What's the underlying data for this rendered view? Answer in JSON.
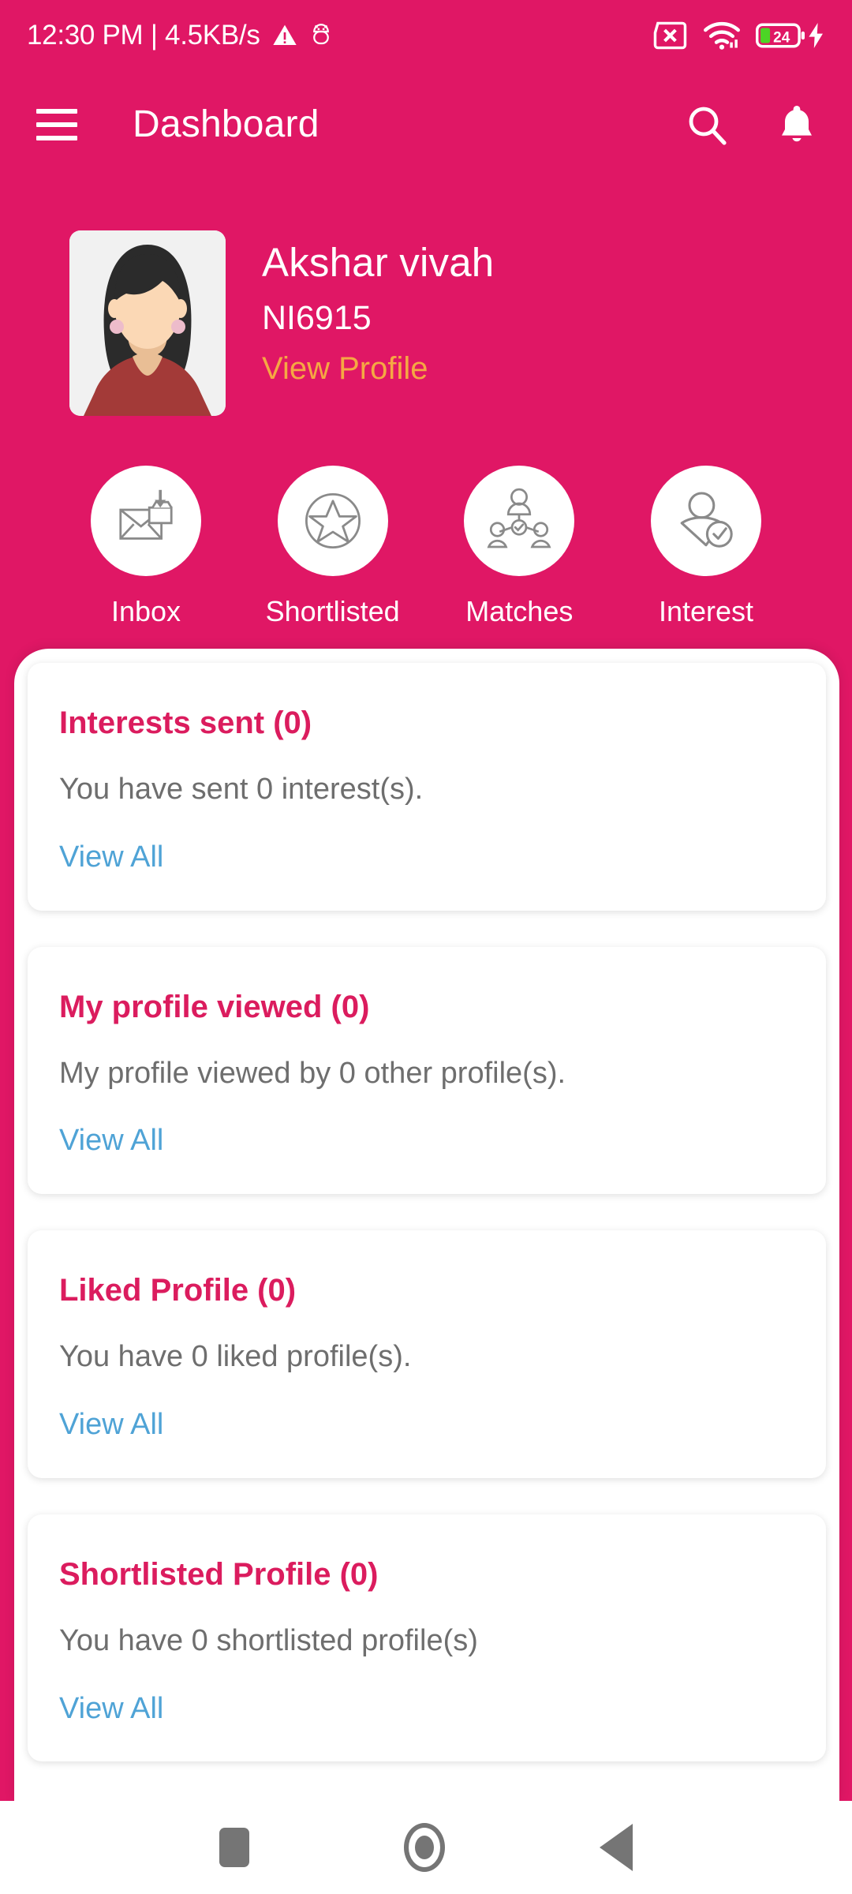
{
  "status_bar": {
    "clock": "12:30 PM | 4.5KB/s",
    "warning_icon": "warning-triangle-icon",
    "droid_icon": "android-debug-icon",
    "sim_icon": "sim-card-error-icon",
    "wifi_icon": "wifi-icon",
    "battery_level": "24",
    "charging_icon": "charging-bolt-icon",
    "battery_color": "#4CD525"
  },
  "app_bar": {
    "menu_icon": "hamburger-menu-icon",
    "title": "Dashboard",
    "search_icon": "search-icon",
    "notification_icon": "bell-icon"
  },
  "profile": {
    "avatar_alt": "user-avatar",
    "name": "Akshar vivah",
    "id": "NI6915",
    "view_profile_label": "View Profile",
    "link_color": "#F5A843"
  },
  "quick_actions": [
    {
      "label": "Inbox",
      "icon": "inbox-envelope-icon"
    },
    {
      "label": "Shortlisted",
      "icon": "star-circle-icon"
    },
    {
      "label": "Matches",
      "icon": "people-network-icon"
    },
    {
      "label": "Interest",
      "icon": "person-check-icon"
    }
  ],
  "cards": [
    {
      "title": "Interests sent (0)",
      "description": "You have sent 0 interest(s).",
      "link": "View All"
    },
    {
      "title": "My profile viewed (0)",
      "description": "My profile viewed by 0 other profile(s).",
      "link": "View All"
    },
    {
      "title": "Liked Profile (0)",
      "description": "You have 0 liked profile(s).",
      "link": "View All"
    },
    {
      "title": "Shortlisted Profile (0)",
      "description": "You have 0 shortlisted profile(s)",
      "link": "View All"
    }
  ],
  "nav_bar": {
    "recents_icon": "recents-square-icon",
    "home_icon": "home-circle-icon",
    "back_icon": "back-triangle-icon"
  },
  "theme": {
    "primary": "#E01765",
    "card_title": "#DB1C5E",
    "link_blue": "#4FA3D6",
    "body_text": "#6E6E6E"
  }
}
